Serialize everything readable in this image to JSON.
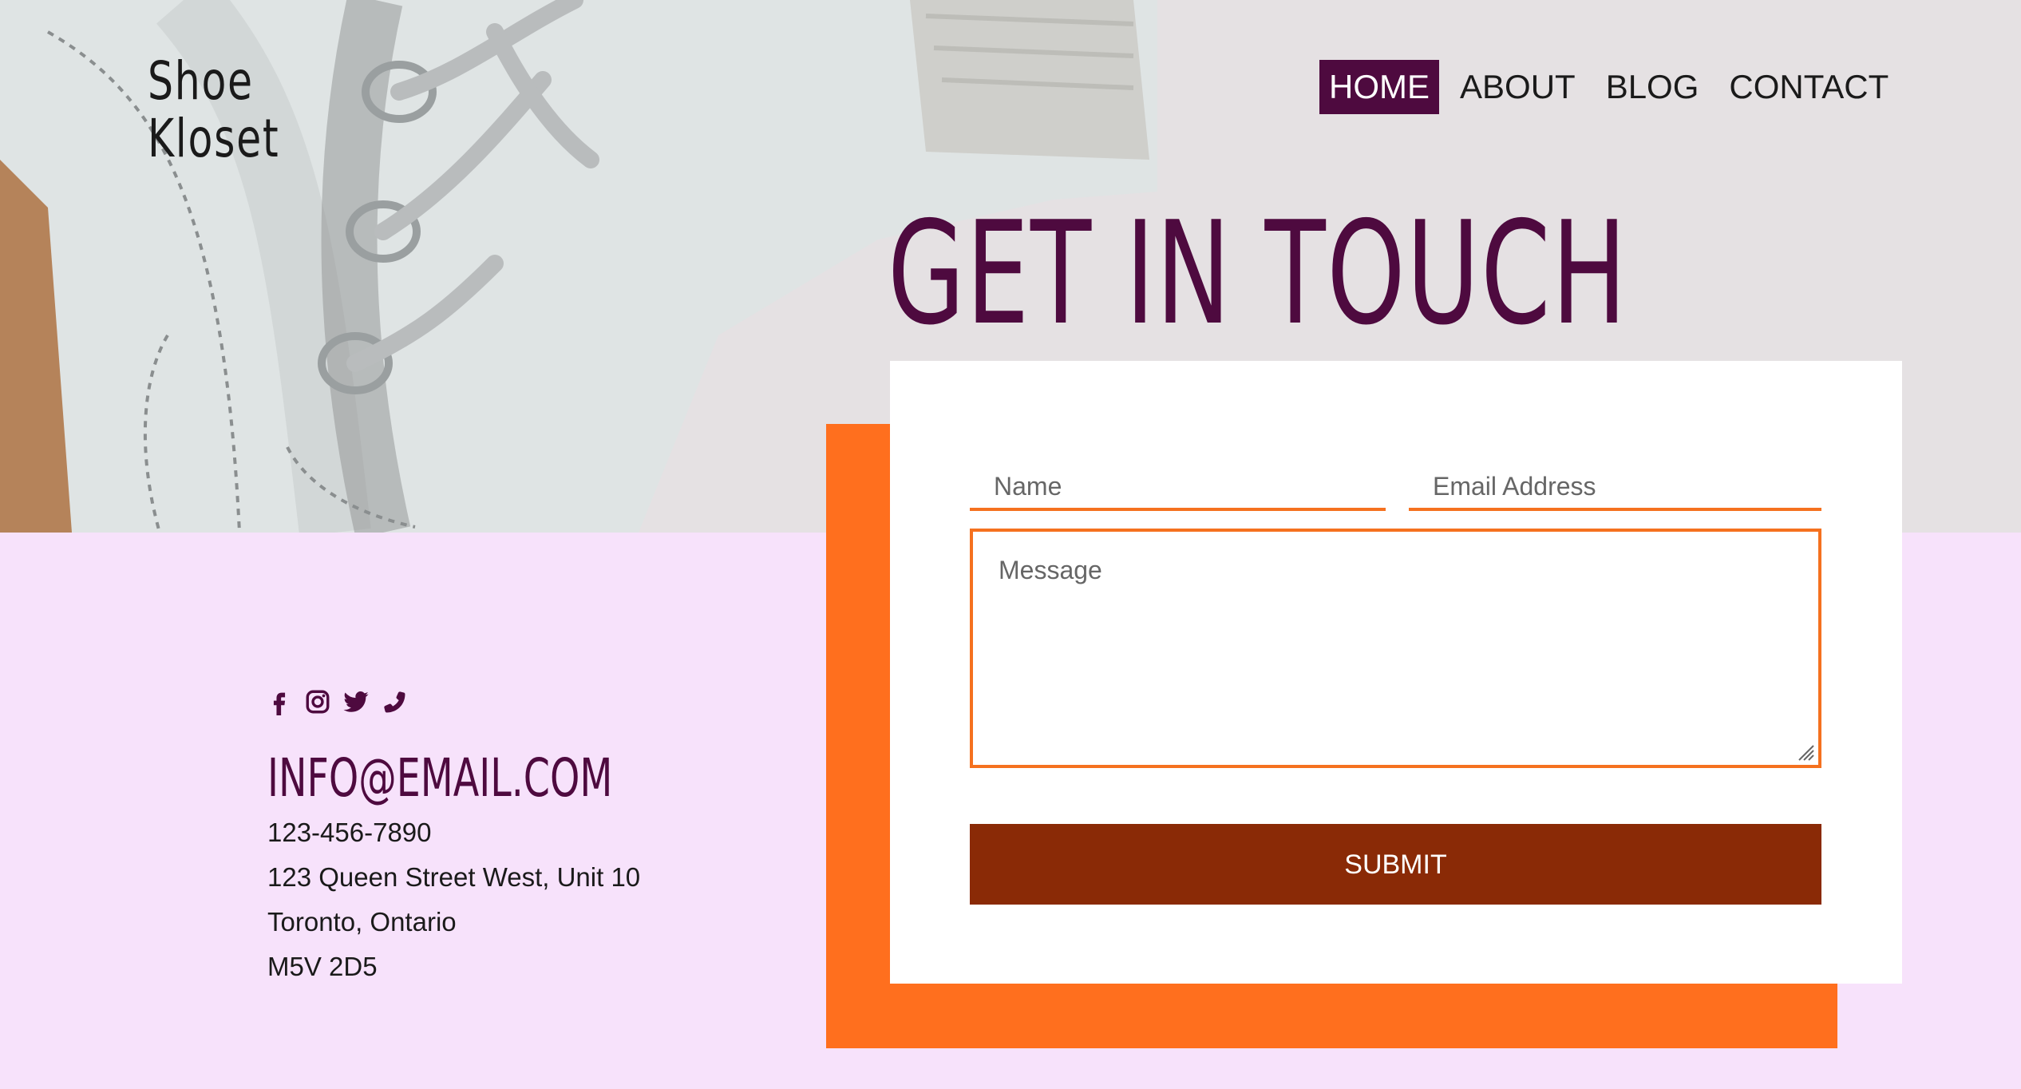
{
  "brand": {
    "line1": "Shoe",
    "line2": "Kloset"
  },
  "nav": [
    {
      "label": "HOME",
      "active": true
    },
    {
      "label": "ABOUT",
      "active": false
    },
    {
      "label": "BLOG",
      "active": false
    },
    {
      "label": "CONTACT",
      "active": false
    }
  ],
  "page_title": "GET IN TOUCH",
  "form": {
    "name_placeholder": "Name",
    "name_value": "",
    "email_placeholder": "Email Address",
    "email_value": "",
    "message_placeholder": "Message",
    "message_value": "",
    "submit_label": "SUBMIT"
  },
  "social_icons": [
    "facebook-icon",
    "instagram-icon",
    "twitter-icon",
    "phone-icon"
  ],
  "contact": {
    "email": "INFO@EMAIL.COM",
    "phone": "123-456-7890",
    "address_line1": "123 Queen Street West, Unit 10",
    "address_line2": "Toronto, Ontario",
    "postal_code": "M5V 2D5"
  },
  "colors": {
    "accent_purple": "#4e0a3f",
    "orange": "#ff6f1e",
    "submit": "#8a2a06",
    "bg_pink": "#f7e2fb",
    "hero_grey": "#e5e1e3"
  }
}
